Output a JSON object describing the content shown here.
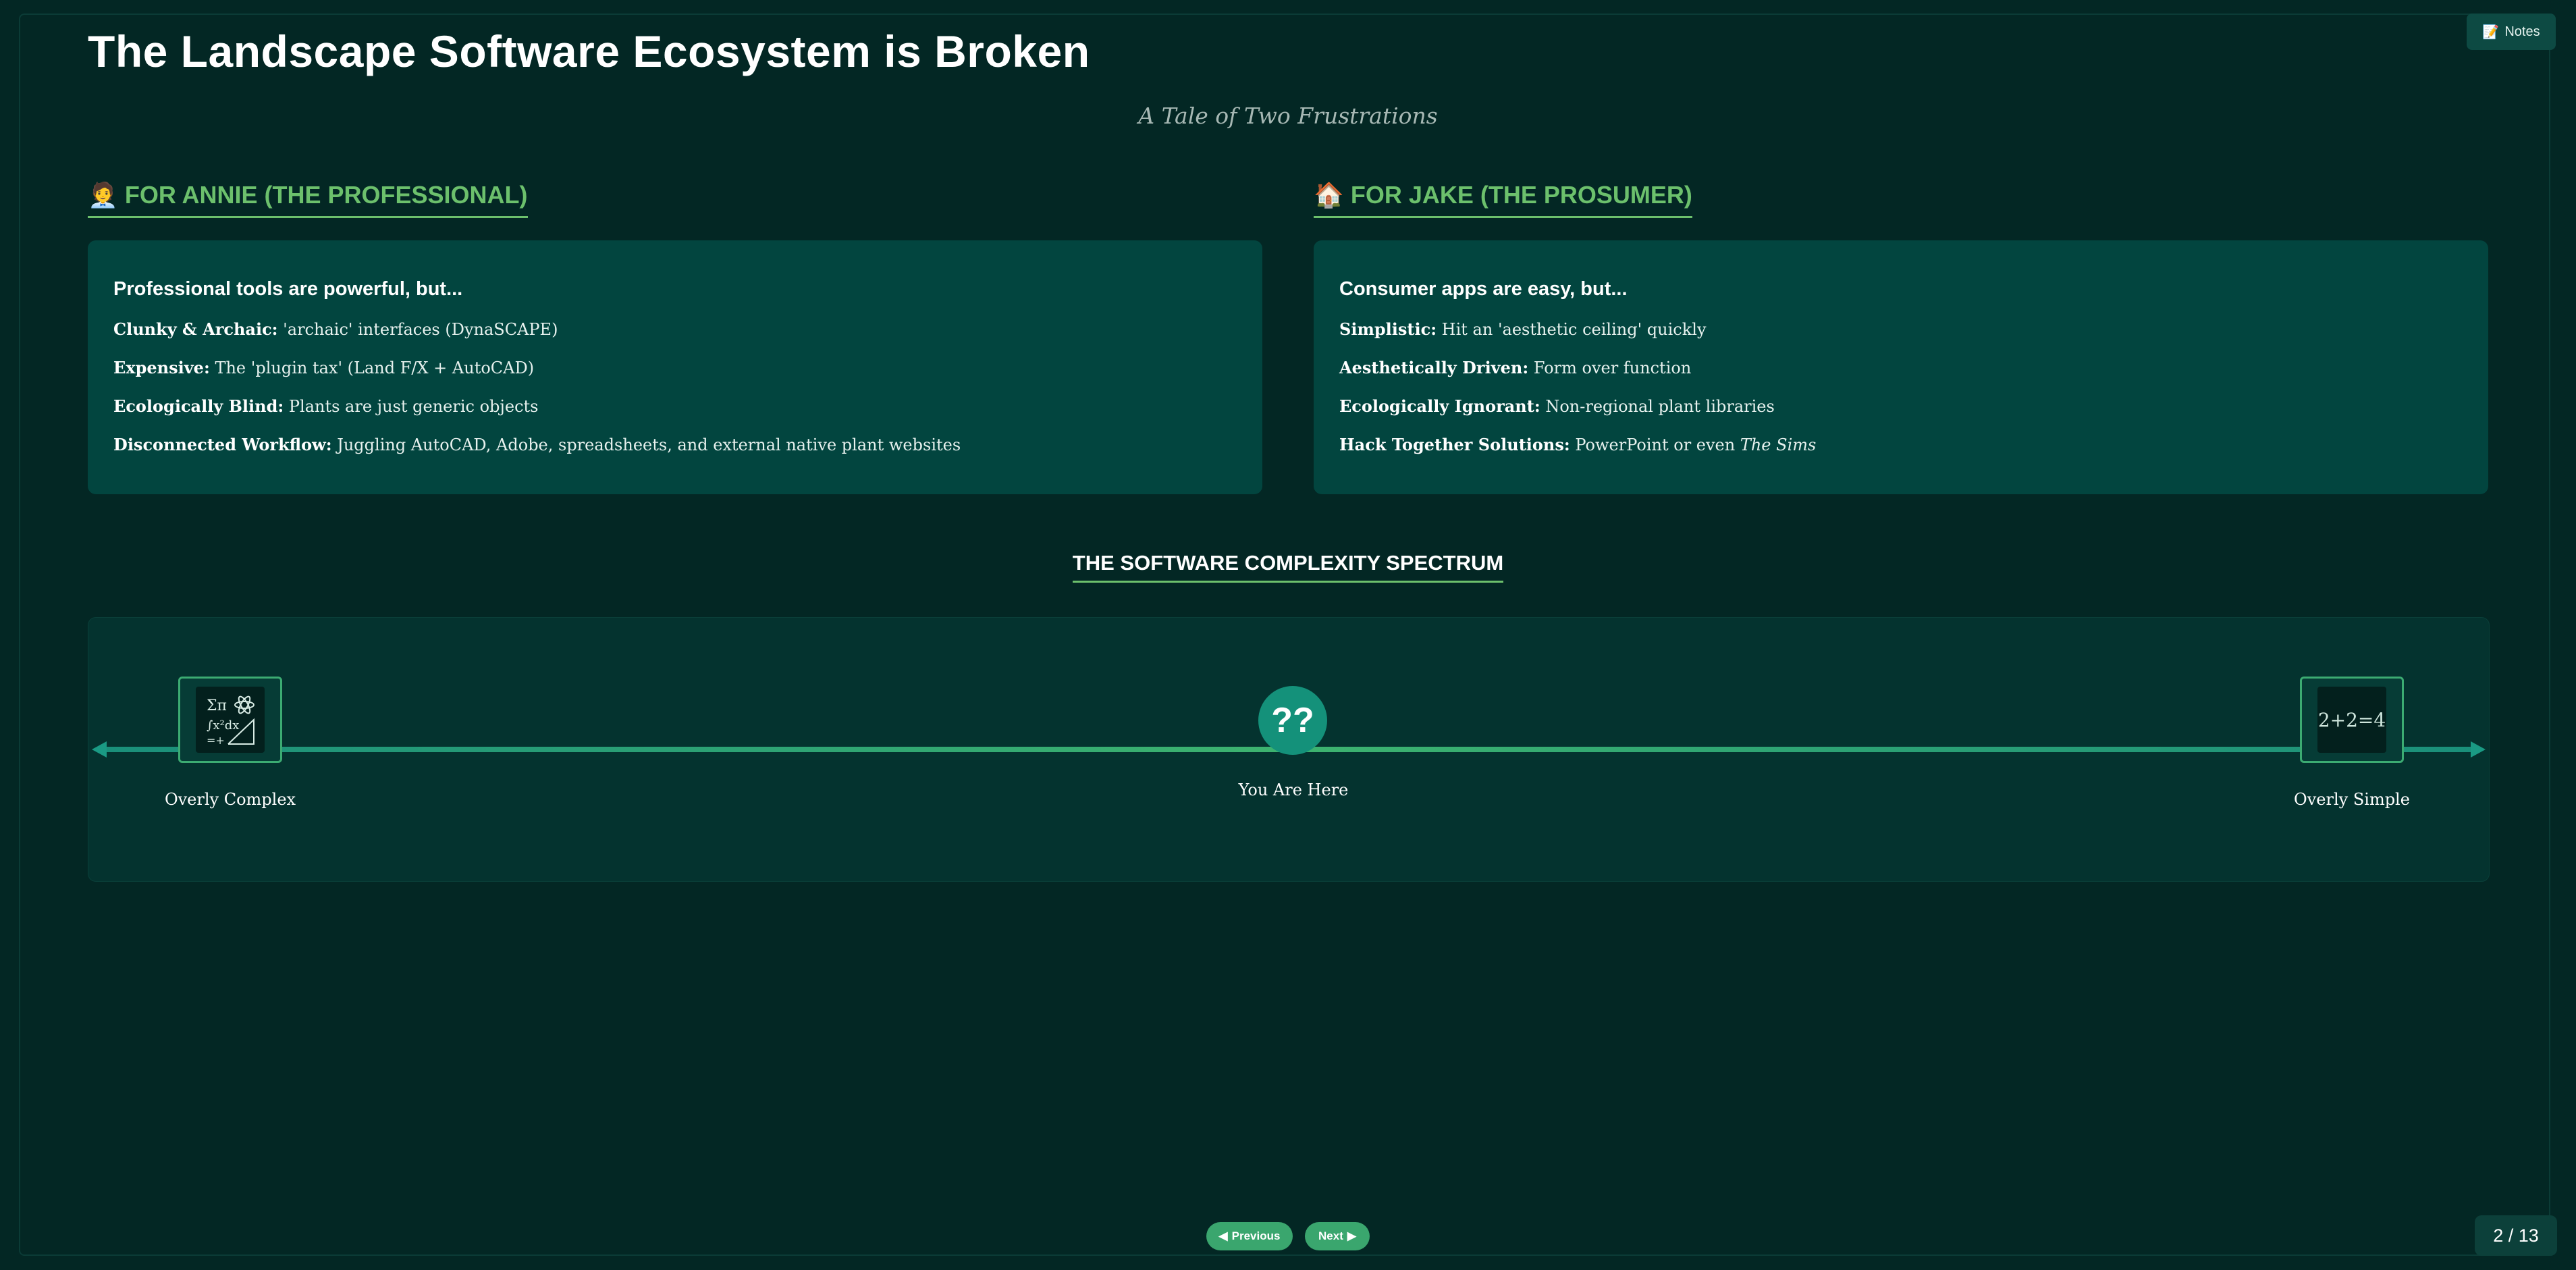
{
  "notes": {
    "icon": "memo-icon",
    "icon_glyph": "📝",
    "label": "Notes"
  },
  "title": "The Landscape Software Ecosystem is Broken",
  "subtitle": "A Tale of Two Frustrations",
  "left": {
    "icon": "professional-person-icon",
    "icon_glyph": "🧑‍💼",
    "heading": "FOR ANNIE (THE PROFESSIONAL)",
    "lead": "Professional tools are powerful, but...",
    "rows": [
      {
        "term": "Clunky & Archaic:",
        "text": " 'archaic' interfaces (DynaSCAPE)"
      },
      {
        "term": "Expensive:",
        "text": " The 'plugin tax' (Land F/X + AutoCAD)"
      },
      {
        "term": "Ecologically Blind:",
        "text": " Plants are just generic objects"
      },
      {
        "term": "Disconnected Workflow:",
        "text": " Juggling AutoCAD, Adobe, spreadsheets, and external native plant websites"
      }
    ]
  },
  "right": {
    "icon": "house-icon",
    "icon_glyph": "🏠",
    "heading": "FOR JAKE (THE PROSUMER)",
    "lead": "Consumer apps are easy, but...",
    "rows": [
      {
        "term": "Simplistic:",
        "text": " Hit an 'aesthetic ceiling' quickly"
      },
      {
        "term": "Aesthetically Driven:",
        "text": " Form over function"
      },
      {
        "term": "Ecologically Ignorant:",
        "text": " Non-regional plant libraries"
      },
      {
        "term": "Hack Together Solutions:",
        "text": " PowerPoint or even ",
        "italic": "The Sims"
      }
    ]
  },
  "spectrum": {
    "heading": "THE SOFTWARE COMPLEXITY SPECTRUM",
    "left_label": "Overly Complex",
    "left_icon": "complex-math-icon",
    "center_glyph": "??",
    "center_label": "You Are Here",
    "right_label": "Overly Simple",
    "right_icon": "simple-math-icon",
    "right_text": "2+2=4"
  },
  "nav": {
    "previous_label": "Previous",
    "next_label": "Next",
    "page": "2 / 13"
  }
}
